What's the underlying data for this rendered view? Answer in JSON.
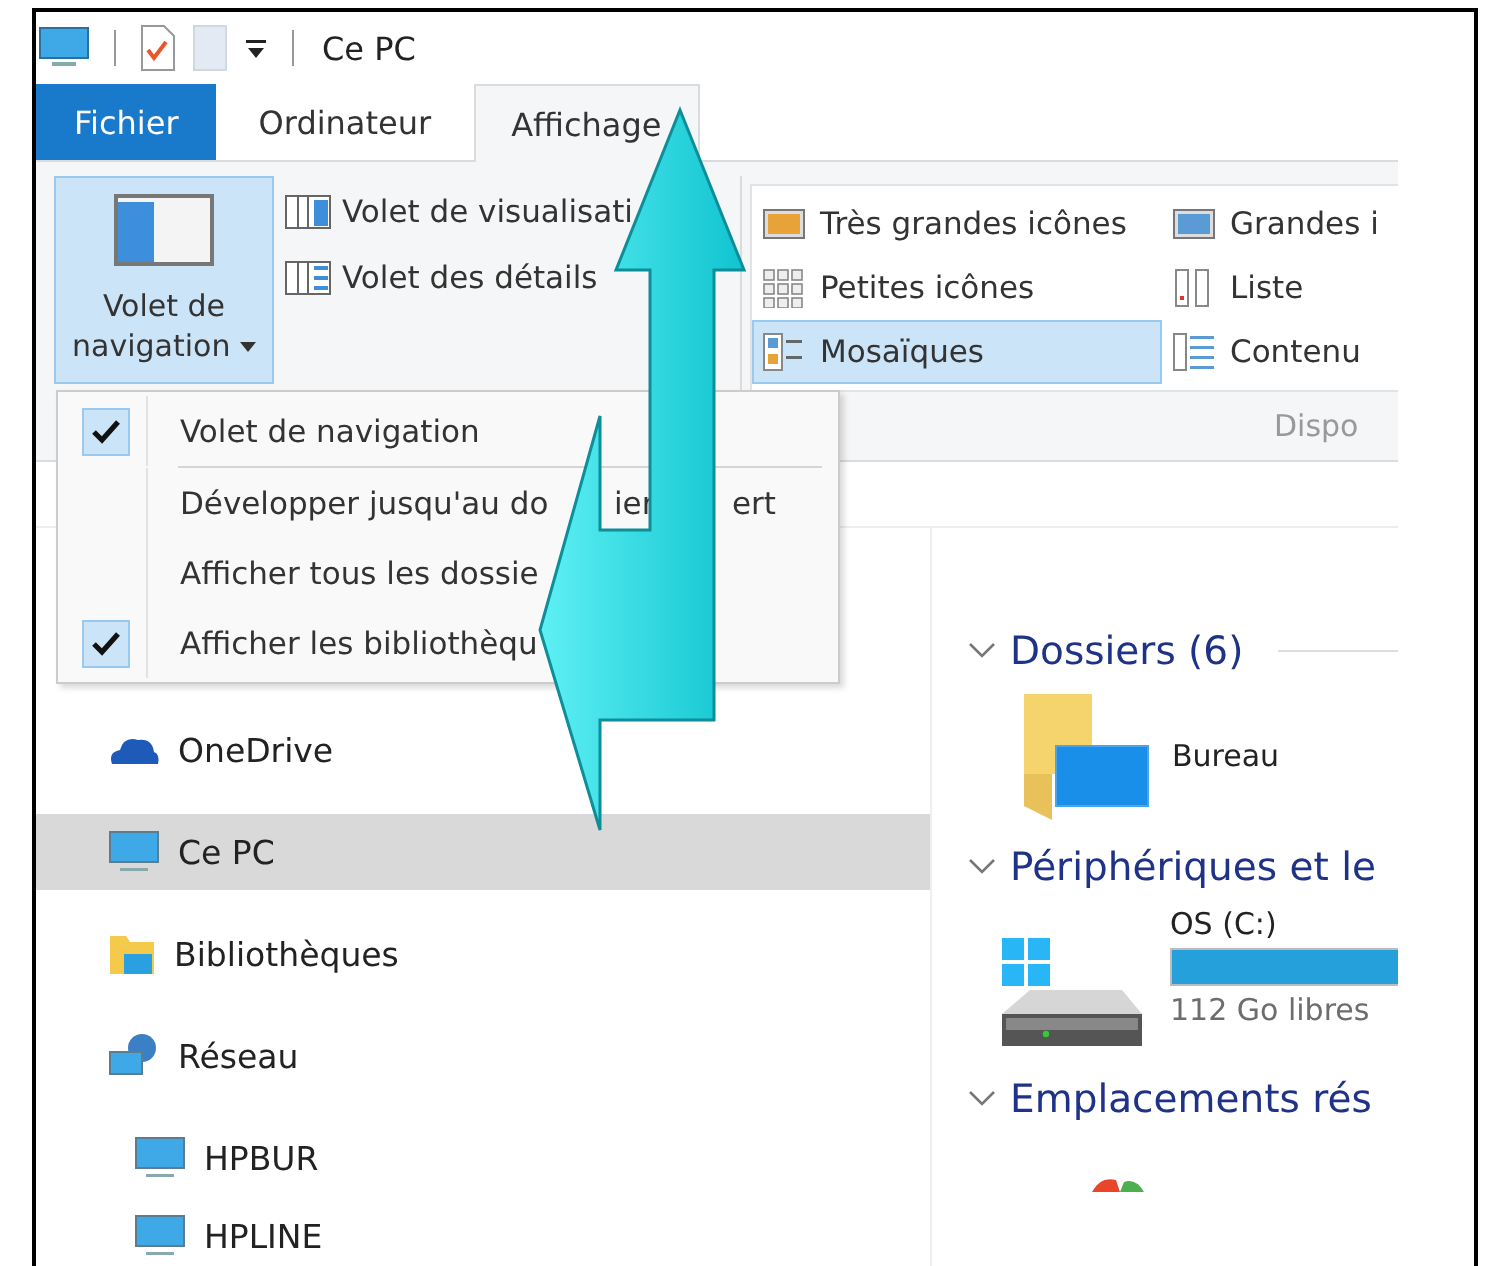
{
  "window": {
    "title": "Ce PC"
  },
  "tabs": [
    {
      "label": "Fichier",
      "kind": "file",
      "selected": false
    },
    {
      "label": "Ordinateur",
      "kind": "tab",
      "selected": false
    },
    {
      "label": "Affichage",
      "kind": "tab",
      "selected": true
    }
  ],
  "ribbon": {
    "nav_button": {
      "label": "Volet de navigation",
      "pressed": true
    },
    "pane_items": [
      {
        "label": "Volet de visualisati",
        "kind": "preview"
      },
      {
        "label": "Volet des détails",
        "kind": "details"
      }
    ],
    "layout_items": [
      {
        "label": "Très grandes icônes",
        "kind": "xl",
        "selected": false
      },
      {
        "label": "Grandes i",
        "kind": "large",
        "selected": false
      },
      {
        "label": "Petites icônes",
        "kind": "small",
        "selected": false
      },
      {
        "label": "Liste",
        "kind": "list",
        "selected": false
      },
      {
        "label": "Mosaïques",
        "kind": "tiles",
        "selected": true
      },
      {
        "label": "Contenu",
        "kind": "content",
        "selected": false
      }
    ],
    "layout_group_label": "Dispo"
  },
  "menu": {
    "items": [
      {
        "parts": [
          "Volet de navigation"
        ],
        "checked": true,
        "separator_after": true
      },
      {
        "parts": [
          "Développer jusqu'au do",
          "ier",
          "ert"
        ],
        "checked": false,
        "separator_after": false
      },
      {
        "parts": [
          "Afficher tous les dossie"
        ],
        "checked": false,
        "separator_after": false
      },
      {
        "parts": [
          "Afficher les bibliothèqu"
        ],
        "checked": true,
        "separator_after": false
      }
    ]
  },
  "nav": {
    "items": [
      {
        "label": "OneDrive",
        "kind": "cloud",
        "selected": false
      },
      {
        "label": "Ce PC",
        "kind": "pc",
        "selected": true
      },
      {
        "label": "Bibliothèques",
        "kind": "library",
        "selected": false
      },
      {
        "label": "Réseau",
        "kind": "network",
        "selected": false,
        "children": [
          {
            "label": "HPBUR",
            "kind": "pc",
            "selected": false
          },
          {
            "label": "HPLINE",
            "kind": "pc",
            "selected": false
          }
        ]
      }
    ]
  },
  "content": {
    "sections": [
      {
        "title": "Dossiers (6)",
        "items": [
          {
            "kind": "folder",
            "name": "Bureau"
          }
        ]
      },
      {
        "title": "Périphériques et le",
        "items": [
          {
            "kind": "drive",
            "name": "OS (C:)",
            "level": 1,
            "free": "112 Go libres"
          }
        ]
      },
      {
        "title": "Emplacements rés",
        "items": [
          {
            "kind": "partial"
          }
        ]
      }
    ]
  }
}
